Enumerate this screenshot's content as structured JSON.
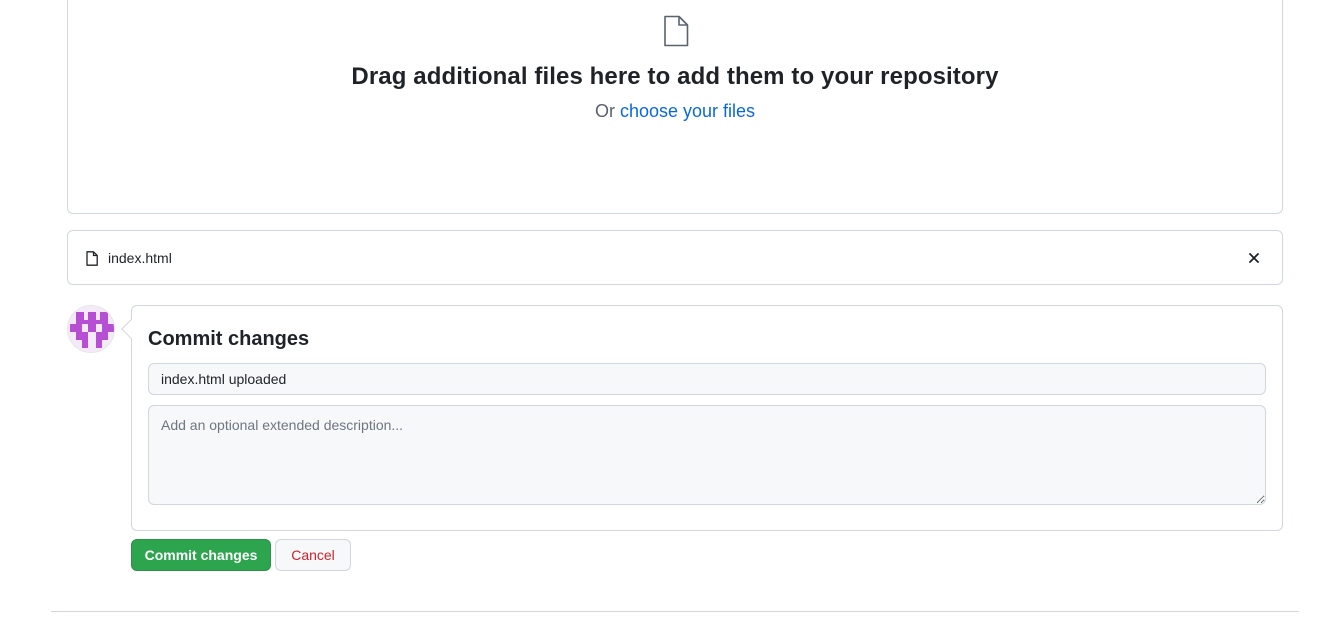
{
  "dropzone": {
    "headline": "Drag additional files here to add them to your repository",
    "or_text": "Or ",
    "choose_link": "choose your files"
  },
  "files": [
    {
      "name": "index.html"
    }
  ],
  "commit": {
    "title": "Commit changes",
    "summary_value": "index.html uploaded",
    "description_placeholder": "Add an optional extended description...",
    "commit_button_label": "Commit changes",
    "cancel_button_label": "Cancel"
  },
  "icons": {
    "upload_area": "file-icon",
    "file_row": "file-icon",
    "remove": "x-icon"
  },
  "colors": {
    "primary_button": "#2da44e",
    "cancel_text": "#cf222e",
    "link": "#0969da",
    "avatar_accent": "#b64fd4"
  }
}
